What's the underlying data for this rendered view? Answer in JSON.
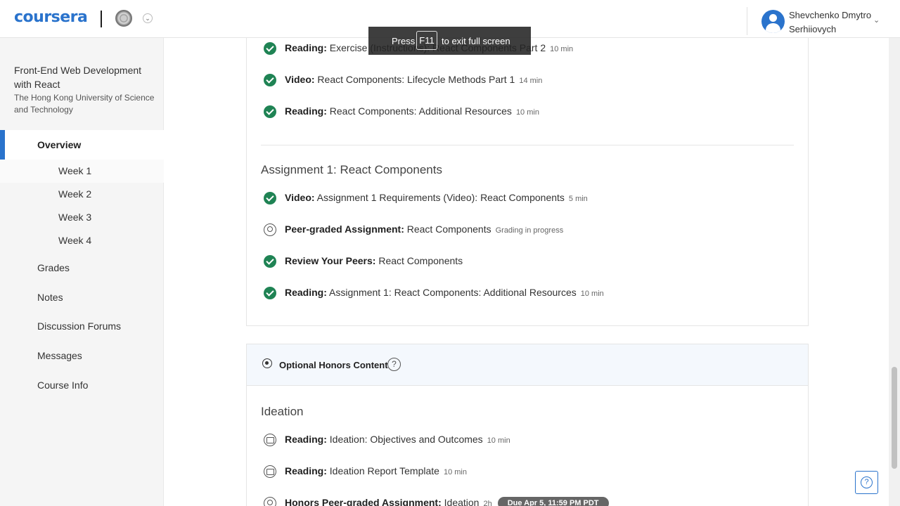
{
  "header": {
    "logo": "coursera",
    "university_icon": "university-seal-icon",
    "user_name": "Shevchenko Dmytro Serhiiovych",
    "brand_color": "#2a73cc"
  },
  "fullscreen_toast": {
    "press": "Press",
    "key": "F11",
    "suffix": "to exit full screen"
  },
  "sidebar": {
    "course_title": "Front-End Web Development with React",
    "course_org": "The Hong Kong University of Science and Technology",
    "overview": "Overview",
    "weeks": [
      "Week 1",
      "Week 2",
      "Week 3",
      "Week 4"
    ],
    "items": [
      "Grades",
      "Notes",
      "Discussion Forums",
      "Messages",
      "Course Info"
    ]
  },
  "lesson_items": [
    {
      "type": "Reading:",
      "title": "Exercise (Instructions): React Components Part 2",
      "duration": "10 min",
      "status": "completed"
    },
    {
      "type": "Video:",
      "title": "React Components: Lifecycle Methods Part 1",
      "duration": "14 min",
      "status": "completed"
    },
    {
      "type": "Reading:",
      "title": "React Components: Additional Resources",
      "duration": "10 min",
      "status": "completed"
    }
  ],
  "assignment": {
    "title": "Assignment 1: React Components",
    "items": [
      {
        "type": "Video:",
        "title": "Assignment 1 Requirements (Video): React Components",
        "duration": "5 min",
        "status": "completed"
      },
      {
        "type": "Peer-graded Assignment:",
        "title": "React Components",
        "duration": "Grading in progress",
        "status": "peer"
      },
      {
        "type": "Review Your Peers:",
        "title": "React Components",
        "duration": "",
        "status": "completed"
      },
      {
        "type": "Reading:",
        "title": "Assignment 1: React Components: Additional Resources",
        "duration": "10 min",
        "status": "completed"
      }
    ]
  },
  "honors": {
    "header": "Optional Honors Content",
    "help": "?",
    "section_title": "Ideation",
    "items": [
      {
        "type": "Reading:",
        "title": "Ideation: Objectives and Outcomes",
        "duration": "10 min",
        "status": "reading"
      },
      {
        "type": "Reading:",
        "title": "Ideation Report Template",
        "duration": "10 min",
        "status": "reading"
      },
      {
        "type": "Honors Peer-graded Assignment:",
        "title": "Ideation",
        "duration": "2h",
        "due": "Due Apr 5, 11:59 PM PDT",
        "status": "peer"
      }
    ]
  },
  "help_fab": "?"
}
